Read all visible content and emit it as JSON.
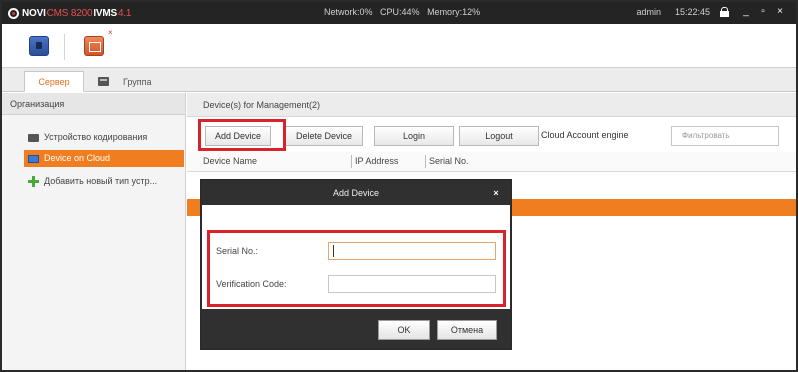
{
  "app": {
    "brand": "NOVI",
    "model": "CMS 8200",
    "product": "IVMS",
    "version": "4.1"
  },
  "status": {
    "network": "Network:0%",
    "cpu": "CPU:44%",
    "memory": "Memory:12%"
  },
  "user": {
    "name": "admin",
    "time": "15:22:45"
  },
  "window": {
    "minimize": "_",
    "restore": "▫",
    "close": "×"
  },
  "toolbar": {
    "close_mark": "×"
  },
  "tabs": [
    {
      "label": "Сервер"
    },
    {
      "label": "Группа"
    }
  ],
  "sidebar": {
    "title": "Организация",
    "items": [
      {
        "label": "Устройство кодирования"
      },
      {
        "label": "Device on Cloud"
      },
      {
        "label": "Добавить новый тип устр..."
      }
    ]
  },
  "main": {
    "header": "Device(s) for Management(2)",
    "buttons": {
      "add": "Add Device",
      "delete": "Delete Device",
      "login": "Login",
      "logout": "Logout"
    },
    "cloud_engine": "Cloud Account engine",
    "filter_placeholder": "Фильтровать",
    "columns": {
      "name": "Device Name",
      "ip": "IP Address",
      "serial": "Serial No."
    }
  },
  "dialog": {
    "title": "Add Device",
    "close": "×",
    "fields": {
      "serial_label": "Serial No.:",
      "serial_value": "",
      "verification_label": "Verification Code:",
      "verification_value": ""
    },
    "ok": "OK",
    "cancel": "Отмена"
  },
  "colors": {
    "accent": "#f07d20",
    "highlight": "#d8232a",
    "titlebar": "#242424"
  }
}
